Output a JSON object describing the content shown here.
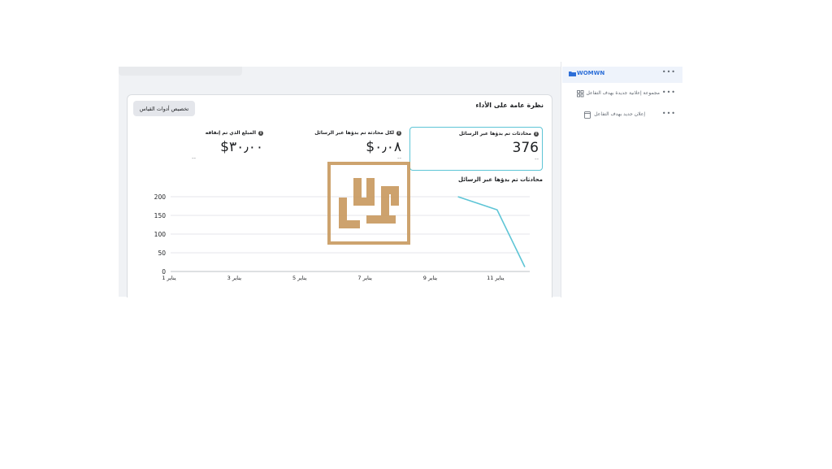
{
  "panel": {
    "title": "نظرة عامة على الأداء",
    "customize_button": "تخصيص أدوات القياس"
  },
  "metrics": [
    {
      "label": "محادثات تم بدؤها عبر الرسائل",
      "value": "376",
      "compare": "--",
      "selected": true
    },
    {
      "label": "لكل محادثة تم بدؤها عبر الرسائل",
      "value": "$٠٫٠٨",
      "compare": "--"
    },
    {
      "label": "المبلغ الذي تم إنفاقه",
      "value": "$٣٠٫٠٠",
      "compare": "--"
    }
  ],
  "chart_title": "محادثات تم بدؤها عبر الرسائل",
  "chart_data": {
    "type": "line",
    "title": "محادثات تم بدؤها عبر الرسائل",
    "x": [
      "1 يناير",
      "3 يناير",
      "5 يناير",
      "7 يناير",
      "9 يناير",
      "11 يناير"
    ],
    "y_ticks": [
      0,
      50,
      100,
      150,
      200
    ],
    "ylim": [
      0,
      200
    ],
    "series": [
      {
        "color": "#5ec5d6",
        "points": [
          [
            9.8,
            200
          ],
          [
            11,
            165
          ],
          [
            11.85,
            12
          ]
        ]
      }
    ],
    "grid": true
  },
  "sidebar": {
    "campaign": {
      "name": "WOMWN",
      "more": "•••"
    },
    "adset": {
      "name": "مجموعة إعلانية جديدة بهدف التفاعل",
      "more": "•••"
    },
    "ad": {
      "name": "إعلان جديد بهدف التفاعل",
      "more": "•••"
    }
  },
  "colors": {
    "accent": "#5ec5d6",
    "link": "#2d6fd8",
    "watermark": "#c8995e"
  },
  "icons": {
    "info": "info-icon",
    "folder": "folder-icon",
    "grid": "grid-icon",
    "ad": "ad-icon"
  }
}
